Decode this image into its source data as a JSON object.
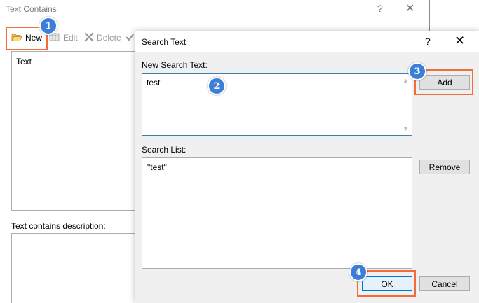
{
  "background_window": {
    "title": "Text Contains",
    "help_glyph": "?",
    "close_glyph": "✕",
    "toolbar": {
      "new_label": "New",
      "edit_label": "Edit",
      "delete_label": "Delete"
    },
    "list_items": [
      "Text"
    ],
    "description_label": "Text contains description:"
  },
  "dialog": {
    "title": "Search Text",
    "help_glyph": "?",
    "close_glyph": "✕",
    "new_search_label": "New Search Text:",
    "new_search_value": "test",
    "search_list_label": "Search List:",
    "search_list_items": [
      "\"test\""
    ],
    "buttons": {
      "add": "Add",
      "remove": "Remove",
      "ok": "OK",
      "cancel": "Cancel"
    }
  },
  "annotations": {
    "step1": "1",
    "step2": "2",
    "step3": "3",
    "step4": "4",
    "highlight_color": "#f26b3a",
    "badge_color": "#3b7fd9"
  },
  "icons": {
    "new": "folder-open-icon",
    "edit": "edit-table-icon",
    "delete": "delete-x-icon",
    "check": "checkmark-icon"
  }
}
